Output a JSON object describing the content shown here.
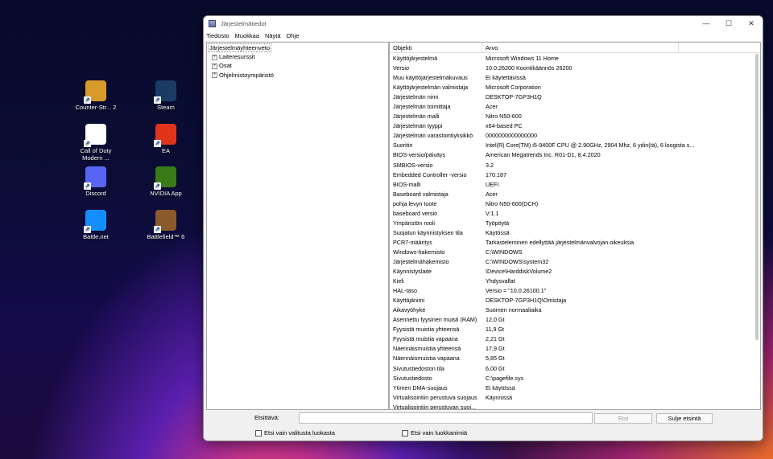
{
  "desktop": {
    "icons": [
      {
        "label": "Counter-Str... 2",
        "icon": "counter-strike-icon",
        "color": "#d89a2a"
      },
      {
        "label": "Steam",
        "icon": "steam-icon",
        "color": "#1b3b66"
      },
      {
        "label": "Call of Duty Modern ...",
        "icon": "file-icon",
        "color": "#ffffff"
      },
      {
        "label": "EA",
        "icon": "ea-icon",
        "color": "#e0341c"
      },
      {
        "label": "Discord",
        "icon": "discord-icon",
        "color": "#5865f2"
      },
      {
        "label": "NVIDIA App",
        "icon": "nvidia-icon",
        "color": "#3a7a18"
      },
      {
        "label": "Battle.net",
        "icon": "battlenet-icon",
        "color": "#148eff"
      },
      {
        "label": "Battlefield™ 6",
        "icon": "battlefield-icon",
        "color": "#8a5a2a"
      }
    ]
  },
  "window": {
    "title": "Järjestelmätiedot",
    "minimize": "—",
    "maximize": "☐",
    "close": "✕"
  },
  "menu": [
    "Tiedosto",
    "Muokkaa",
    "Näytä",
    "Ohje"
  ],
  "tree": {
    "root": "Järjestelmäyhteenveto",
    "items": [
      "Laiteresurssit",
      "Osat",
      "Ohjelmistoympäristö"
    ],
    "expander": "+"
  },
  "details": {
    "col_item": "Objekti",
    "col_value": "Arvo",
    "rows": [
      {
        "k": "Käyttöjärjestelmä",
        "v": "Microsoft Windows 11 Home"
      },
      {
        "k": "Versio",
        "v": "10.0.26200 Koontikäännös 26200"
      },
      {
        "k": "Muu käyttöjärjestelmäkuvaus",
        "v": "Ei käytettävissä"
      },
      {
        "k": "Käyttöjärjestelmän valmistaja",
        "v": "Microsoft Corporation"
      },
      {
        "k": "Järjestelmän nimi",
        "v": "DESKTOP-7GP3H1Q"
      },
      {
        "k": "Järjestelmän toimittaja",
        "v": "Acer"
      },
      {
        "k": "Järjestelmän malli",
        "v": "Nitro N50-600"
      },
      {
        "k": "Järjestelmän tyyppi",
        "v": "x64-based PC"
      },
      {
        "k": "Järjestelmän varastointiyksikkö",
        "v": "0000000000000000"
      },
      {
        "k": "Suoritin",
        "v": "Intel(R) Core(TM) i5-9400F CPU @ 2.90GHz, 2904 Mhz, 6 ydin(tä), 6 loogista s..."
      },
      {
        "k": "BIOS-versio/päiväys",
        "v": "American Megatrends Inc. R01-D1, 8.4.2020"
      },
      {
        "k": "SMBIOS-versio",
        "v": "3.2"
      },
      {
        "k": "Embedded Controller -versio",
        "v": "170.187"
      },
      {
        "k": "BIOS-malli",
        "v": "UEFI"
      },
      {
        "k": "Baseboard valmistaja",
        "v": "Acer"
      },
      {
        "k": " pohja levyn tuote",
        "v": "Nitro N50-600(DCH)"
      },
      {
        "k": "baseboard versio",
        "v": "V:1.1"
      },
      {
        "k": "Ympäristön rooli",
        "v": "Työpöytä"
      },
      {
        "k": "Suojatun käynnistyksen tila",
        "v": "Käytössä"
      },
      {
        "k": "PCR7-määritys",
        "v": "Tarkasteleminen edellyttää järjestelmänvalvojan oikeuksia"
      },
      {
        "k": "Windows-hakemisto",
        "v": "C:\\WINDOWS"
      },
      {
        "k": "Järjestelmähakemisto",
        "v": "C:\\WINDOWS\\system32"
      },
      {
        "k": "Käynnistyslaite",
        "v": "\\Device\\HarddiskVolume2"
      },
      {
        "k": "Kieli",
        "v": "Yhdysvallat"
      },
      {
        "k": "HAL-taso",
        "v": "Versio = \"10.0.26100.1\""
      },
      {
        "k": "Käyttäjänimi",
        "v": "DESKTOP-7GP3H1Q\\Omistaja"
      },
      {
        "k": "Aikavyöhyke",
        "v": "Suomen normaaliaika"
      },
      {
        "k": "Asennettu fyysinen muisti (RAM)",
        "v": "12,0 Gt"
      },
      {
        "k": "Fyysistä muistia yhteensä",
        "v": "11,9 Gt"
      },
      {
        "k": "Fyysistä muistia vapaana",
        "v": "2,21 Gt"
      },
      {
        "k": "Näennäismuistia yhteensä",
        "v": "17,9 Gt"
      },
      {
        "k": "Näennäismuistia vapaana",
        "v": "5,85 Gt"
      },
      {
        "k": "Sivutustiedoston tila",
        "v": "6,00 Gt"
      },
      {
        "k": "Sivutustiedosto",
        "v": "C:\\pagefile.sys"
      },
      {
        "k": "Ytimen DMA-suojaus",
        "v": "Ei käytössä"
      },
      {
        "k": "Virtualisointiin perustuva suojaus",
        "v": "Käynnissä"
      },
      {
        "k": "Virtualisointiin perustuvan suoj...",
        "v": ""
      }
    ]
  },
  "find": {
    "label": "Etsittävä:",
    "value": "",
    "find_button": "Etsi",
    "close_button": "Sulje etsintä",
    "selected_only": "Etsi vain valitusta luokasta",
    "category_names": "Etsi vain luokkanimiä"
  }
}
